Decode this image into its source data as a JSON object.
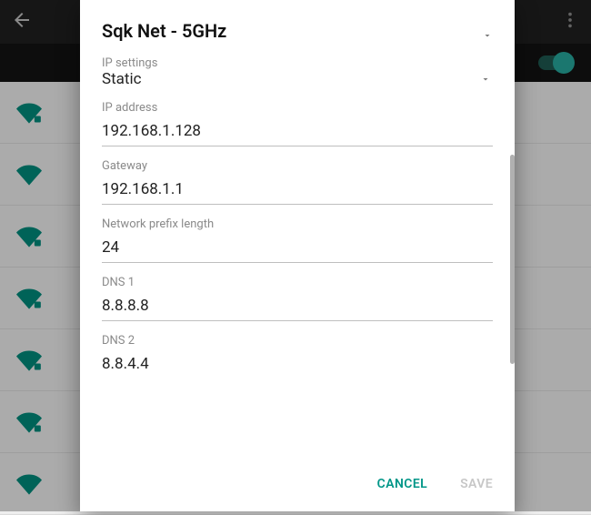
{
  "header": {
    "back_icon": "back-arrow",
    "overflow_icon": "overflow-menu"
  },
  "wifi_toggle": {
    "on": true
  },
  "dialog": {
    "title": "Sqk Net - 5GHz",
    "ip_settings_label": "IP settings",
    "ip_settings_value": "Static",
    "fields": {
      "ip_address": {
        "label": "IP address",
        "value": "192.168.1.128"
      },
      "gateway": {
        "label": "Gateway",
        "value": "192.168.1.1"
      },
      "prefix_length": {
        "label": "Network prefix length",
        "value": "24"
      },
      "dns1": {
        "label": "DNS 1",
        "value": "8.8.8.8"
      },
      "dns2": {
        "label": "DNS 2",
        "value": "8.8.4.4"
      }
    },
    "cancel_label": "CANCEL",
    "save_label": "SAVE"
  },
  "colors": {
    "accent": "#009688",
    "wifi_icon": "#00897b"
  }
}
